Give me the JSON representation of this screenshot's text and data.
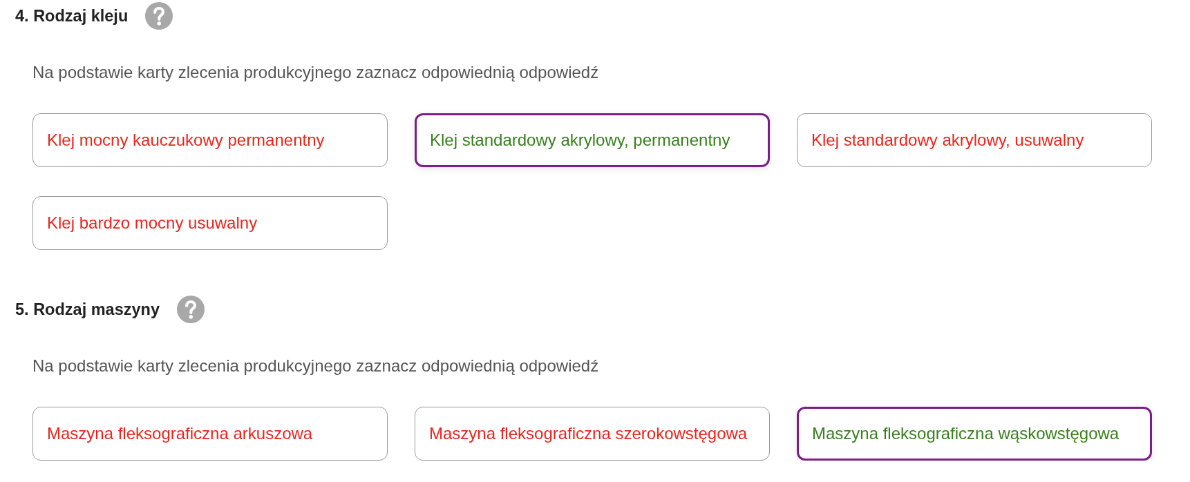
{
  "sections": [
    {
      "title": "4. Rodzaj kleju",
      "instruction": "Na podstawie karty zlecenia produkcyjnego zaznacz odpowiednią odpowiedź",
      "options": [
        {
          "label": "Klej mocny kauczukowy permanentny",
          "selected": false,
          "correct": false
        },
        {
          "label": "Klej standardowy akrylowy, permanentny",
          "selected": true,
          "correct": true
        },
        {
          "label": "Klej standardowy akrylowy, usuwalny",
          "selected": false,
          "correct": false
        },
        {
          "label": "Klej bardzo mocny usuwalny",
          "selected": false,
          "correct": false
        }
      ]
    },
    {
      "title": "5. Rodzaj maszyny",
      "instruction": "Na podstawie karty zlecenia produkcyjnego zaznacz odpowiednią odpowiedź",
      "options": [
        {
          "label": "Maszyna fleksograficzna arkuszowa",
          "selected": false,
          "correct": false
        },
        {
          "label": "Maszyna fleksograficzna szerokowstęgowa",
          "selected": false,
          "correct": false
        },
        {
          "label": "Maszyna fleksograficzna wąskowstęgowa",
          "selected": true,
          "correct": true
        }
      ]
    }
  ]
}
